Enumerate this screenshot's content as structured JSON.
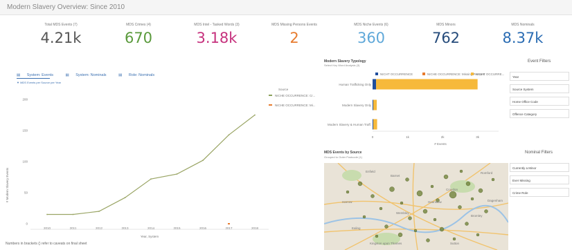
{
  "header": {
    "title": "Modern Slavery Overview: Since 2010"
  },
  "kpis": [
    {
      "label": "Total MDS Events (7)",
      "value": "4.21k",
      "color": "#555555"
    },
    {
      "label": "MDS Crimes (4)",
      "value": "670",
      "color": "#5a9a3c"
    },
    {
      "label": "MDS Intel - Tasked Words (3)",
      "value": "3.18k",
      "color": "#c6317d"
    },
    {
      "label": "MDS Missing Persons Events",
      "value": "2",
      "color": "#e77b2e"
    },
    {
      "label": "MDS Niche Events (6)",
      "value": "360",
      "color": "#5fa8d9"
    },
    {
      "label": "MDS Minors",
      "value": "762",
      "color": "#244a7a"
    },
    {
      "label": "MDS Nominals",
      "value": "8.37k",
      "color": "#2a6cb3"
    }
  ],
  "tabs": [
    "System: Events",
    "System: Nominals",
    "Role: Nominals"
  ],
  "line_chart": {
    "subtitle": "MDS Events per Source per Year",
    "legend_title": "Source",
    "legend_items": [
      {
        "label": "NICHE OCCURRENCE: Cr...",
        "color": "#8aa05a"
      },
      {
        "label": "NICHE OCCURRENCE: Mi...",
        "color": "#e77b2e"
      }
    ]
  },
  "typology": {
    "title": "Modern Slavery Typology",
    "subtitle": "Select Key Word Analysis (3)",
    "legend": [
      {
        "label": "NICHT OCCURRENCE",
        "color": "#1f4e9c"
      },
      {
        "label": "NICHE OCCURRENCE: Missing Persons",
        "color": "#e77b2e"
      },
      {
        "label": "NICHT OCCURRE...",
        "color": "#f6b93b"
      }
    ],
    "x_label": "# Events"
  },
  "map_panel": {
    "title": "MDS Events by Source",
    "subtitle": "Grouped to Outer Postcode (1)",
    "places": [
      "Harrow",
      "Enfield",
      "Barnet",
      "Wembley",
      "Ealing",
      "Hounslow",
      "Croydon",
      "Bromley",
      "Romford",
      "Sutton",
      "Kingston upon Thames",
      "Dagenham"
    ]
  },
  "event_filters": {
    "heading": "Event Filters",
    "items": [
      "Year",
      "Source System",
      "Home Office Code",
      "Offence Category"
    ]
  },
  "nominal_filters": {
    "heading": "Nominal Filters",
    "items": [
      "Currently a Minor",
      "Ever Missing",
      "Crime Role"
    ]
  },
  "footnote": "Numbers in brackets () refer to caveats on final sheet",
  "chart_data": [
    {
      "type": "line",
      "x": [
        "2010",
        "2011",
        "2012",
        "2013",
        "2014",
        "2015",
        "2016",
        "2017",
        "2018"
      ],
      "series": [
        {
          "name": "NICHE OCCURRENCE: Cr...",
          "values": [
            15,
            15,
            20,
            42,
            72,
            80,
            102,
            143,
            175
          ]
        },
        {
          "name": "NICHE OCCURRENCE: Mi...",
          "values": [
            null,
            null,
            null,
            null,
            null,
            null,
            null,
            0,
            null
          ]
        }
      ],
      "xlabel": "Year, System",
      "ylabel": "# Modern Slavery Events",
      "yticks": [
        "0",
        "50",
        "100",
        "150",
        "200"
      ],
      "ylim": [
        0,
        200
      ],
      "grid": false,
      "legend": "right"
    },
    {
      "type": "bar",
      "orientation": "horizontal",
      "stacked": true,
      "categories": [
        "Human Trafficking Only",
        "Modern Slavery Only",
        "Modern Slavery & Human Traff."
      ],
      "series": [
        {
          "name": "NICHT OCCURRENCE",
          "values": [
            100,
            20,
            20
          ]
        },
        {
          "name": "NICHE OCCURRENCE: Missing Persons",
          "values": [
            0,
            0,
            0
          ]
        },
        {
          "name": "NICHT OCCURRE...",
          "values": [
            2900,
            100,
            110
          ]
        }
      ],
      "xticks": [
        "0",
        "1k",
        "2k",
        "3k"
      ],
      "xlim": [
        0,
        3600
      ],
      "xlabel": "# Events"
    }
  ]
}
